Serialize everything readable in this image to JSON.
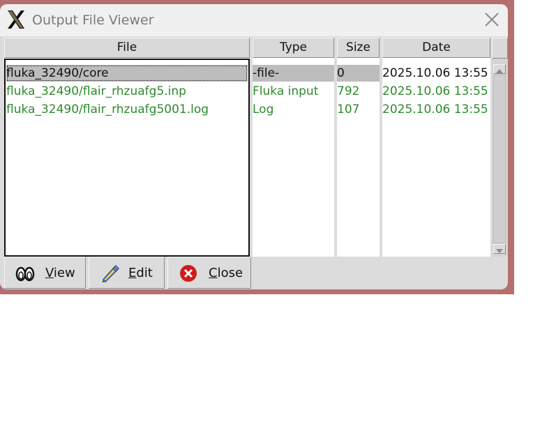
{
  "window": {
    "title": "Output File Viewer"
  },
  "columns": {
    "file": "File",
    "type": "Type",
    "size": "Size",
    "date": "Date"
  },
  "rows": [
    {
      "file": "fluka_32490/core",
      "type": "-file-",
      "size": "0",
      "date": "2025.10.06 13:55",
      "selected": true
    },
    {
      "file": "fluka_32490/flair_rhzuafg5.inp",
      "type": "Fluka input",
      "size": "792",
      "date": "2025.10.06 13:55",
      "selected": false
    },
    {
      "file": "fluka_32490/flair_rhzuafg5001.log",
      "type": "Log",
      "size": "107",
      "date": "2025.10.06 13:55",
      "selected": false
    }
  ],
  "buttons": {
    "view": {
      "mnemonic": "V",
      "rest": "iew",
      "icon": "binoculars-icon"
    },
    "edit": {
      "mnemonic": "E",
      "rest": "dit",
      "icon": "pencil-icon"
    },
    "close": {
      "mnemonic": "C",
      "rest": "lose",
      "icon": "close-circle-icon"
    }
  },
  "colors": {
    "row_text": "#2d8a2d",
    "selected_bg": "#bdbdbd",
    "desktop": "#b56f6f"
  }
}
